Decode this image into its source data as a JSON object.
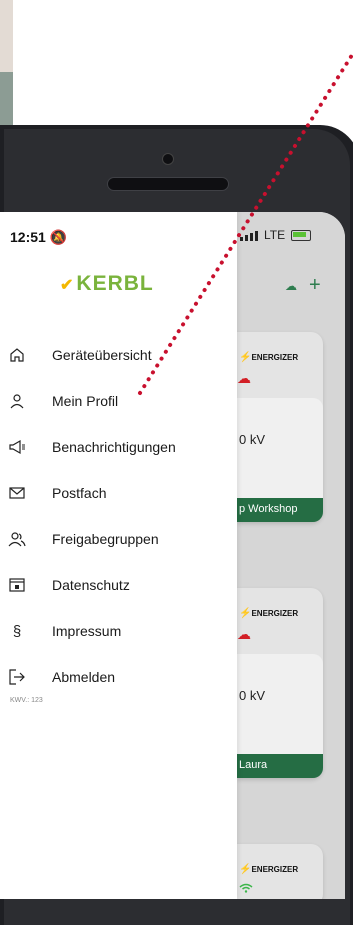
{
  "status_bar": {
    "time": "12:51",
    "network": "LTE"
  },
  "app": {
    "logo_text": "KERBL",
    "version": "KWV.: 123"
  },
  "menu": [
    {
      "label": "Geräteübersicht",
      "icon": "home-icon"
    },
    {
      "label": "Mein Profil",
      "icon": "user-icon"
    },
    {
      "label": "Benachrichtigungen",
      "icon": "megaphone-icon"
    },
    {
      "label": "Postfach",
      "icon": "envelope-icon"
    },
    {
      "label": "Freigabegruppen",
      "icon": "users-icon"
    },
    {
      "label": "Datenschutz",
      "icon": "lock-folder-icon"
    },
    {
      "label": "Impressum",
      "icon": "section-icon"
    },
    {
      "label": "Abmelden",
      "icon": "logout-icon"
    }
  ],
  "devices": [
    {
      "brand": "ENERGIZER",
      "voltage": "0 kV",
      "name": "p Workshop",
      "connection": "offline"
    },
    {
      "brand": "ENERGIZER",
      "voltage": "0 kV",
      "name": "Laura",
      "connection": "offline"
    },
    {
      "brand": "ENERGIZER",
      "connection": "wifi"
    }
  ],
  "colors": {
    "accent": "#256d44",
    "logo": "#7ab33c",
    "alert": "#d31f26"
  }
}
